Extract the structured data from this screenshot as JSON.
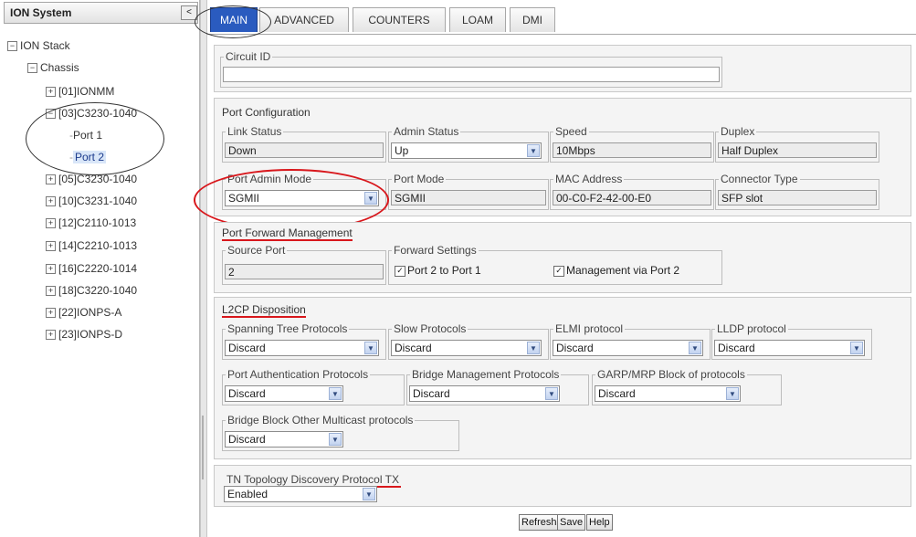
{
  "left_panel": {
    "title": "ION System",
    "root": "ION Stack",
    "chassis": "Chassis",
    "items": [
      "[01]IONMM",
      "[03]C3230-1040",
      "[05]C3230-1040",
      "[10]C3231-1040",
      "[12]C2110-1013",
      "[14]C2210-1013",
      "[16]C2220-1014",
      "[18]C3220-1040",
      "[22]IONPS-A",
      "[23]IONPS-D"
    ],
    "ports": [
      "Port 1",
      "Port 2"
    ]
  },
  "tabs": [
    "MAIN",
    "ADVANCED",
    "COUNTERS",
    "LOAM",
    "DMI"
  ],
  "circuit_id": {
    "label": "Circuit ID",
    "value": ""
  },
  "port_config": {
    "title": "Port Configuration",
    "link_status": {
      "label": "Link Status",
      "value": "Down"
    },
    "admin_status": {
      "label": "Admin Status",
      "value": "Up"
    },
    "speed": {
      "label": "Speed",
      "value": "10Mbps"
    },
    "duplex": {
      "label": "Duplex",
      "value": "Half Duplex"
    },
    "port_admin_mode": {
      "label": "Port Admin Mode",
      "value": "SGMII"
    },
    "port_mode": {
      "label": "Port Mode",
      "value": "SGMII"
    },
    "mac_address": {
      "label": "MAC Address",
      "value": "00-C0-F2-42-00-E0"
    },
    "connector_type": {
      "label": "Connector Type",
      "value": "SFP slot"
    }
  },
  "port_forward": {
    "title": "Port Forward Management",
    "source_port": {
      "label": "Source Port",
      "value": "2"
    },
    "forward_settings": {
      "label": "Forward Settings",
      "opt1": "Port 2 to Port 1",
      "opt2": "Management via Port 2"
    }
  },
  "l2cp": {
    "title": "L2CP Disposition",
    "stp": {
      "label": "Spanning Tree Protocols",
      "value": "Discard"
    },
    "slow": {
      "label": "Slow Protocols",
      "value": "Discard"
    },
    "elmi": {
      "label": "ELMI protocol",
      "value": "Discard"
    },
    "lldp": {
      "label": "LLDP protocol",
      "value": "Discard"
    },
    "pauth": {
      "label": "Port Authentication Protocols",
      "value": "Discard"
    },
    "bmgmt": {
      "label": "Bridge Management Protocols",
      "value": "Discard"
    },
    "garp": {
      "label": "GARP/MRP Block of protocols",
      "value": "Discard"
    },
    "bblock": {
      "label": "Bridge Block Other Multicast protocols",
      "value": "Discard"
    }
  },
  "tn_topology": {
    "label": "TN Topology Discovery Protocol TX",
    "value": "Enabled"
  },
  "buttons": {
    "refresh": "Refresh",
    "save": "Save",
    "help": "Help"
  },
  "icons": {
    "expand": "plus-icon",
    "collapse": "minus-icon",
    "dropdown": "chevron-down-icon",
    "checkbox": "check-icon"
  },
  "colors": {
    "active_tab": "#2a5bbf",
    "annotation_red": "#d8171c"
  }
}
